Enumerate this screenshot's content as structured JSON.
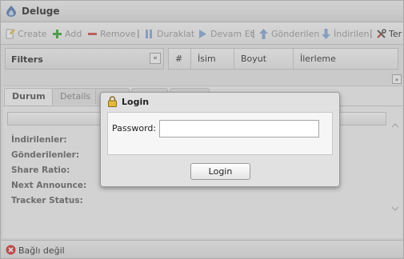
{
  "app": {
    "title": "Deluge"
  },
  "toolbar": {
    "items": [
      {
        "label": "Create",
        "icon": "create-icon"
      },
      {
        "label": "Add",
        "icon": "add-icon"
      },
      {
        "label": "Remove",
        "icon": "remove-icon"
      },
      {
        "label": "Duraklat",
        "icon": "pause-icon"
      },
      {
        "label": "Devam Et",
        "icon": "resume-icon"
      },
      {
        "label": "Gönderilen",
        "icon": "up-icon"
      },
      {
        "label": "İndirilen",
        "icon": "down-icon"
      },
      {
        "label": "Ter",
        "icon": "preferences-icon"
      }
    ],
    "separator": "|"
  },
  "filters": {
    "title": "Filters",
    "collapse_glyph": "«"
  },
  "grid": {
    "columns": [
      "#",
      "İsim",
      "Boyut",
      "İlerleme"
    ],
    "expand_glyph": "»"
  },
  "details": {
    "tabs": [
      "Durum",
      "Details",
      "",
      "",
      ""
    ],
    "fields": [
      "İndirilenler:",
      "Gönderilenler:",
      "Share Ratio:",
      "Next Announce:",
      "Tracker Status:"
    ]
  },
  "status": {
    "text": "Bağlı değil"
  },
  "login": {
    "title": "Login",
    "password_label": "Password:",
    "password_value": "",
    "button": "Login"
  },
  "colors": {
    "accent": "#2f7fd0",
    "add": "#3ea73a",
    "remove": "#d65050",
    "status_error": "#d23a3a"
  }
}
